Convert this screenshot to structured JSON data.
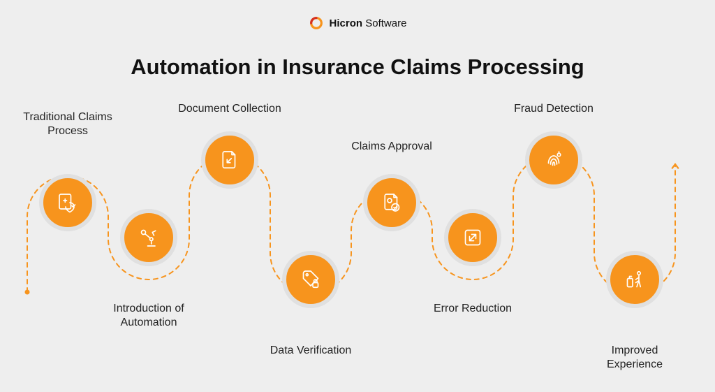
{
  "brand": {
    "name_bold": "Hicron",
    "name_light": "Software"
  },
  "title": "Automation in Insurance Claims Processing",
  "steps": [
    {
      "id": "traditional",
      "label": "Traditional Claims\nProcess",
      "icon": "health-shield"
    },
    {
      "id": "automation",
      "label": "Introduction of\nAutomation",
      "icon": "robot-arm"
    },
    {
      "id": "documents",
      "label": "Document Collection",
      "icon": "doc-arrow"
    },
    {
      "id": "data",
      "label": "Data Verification",
      "icon": "tag-lock"
    },
    {
      "id": "approval",
      "label": "Claims Approval",
      "icon": "doc-check"
    },
    {
      "id": "error",
      "label": "Error Reduction",
      "icon": "square-expand"
    },
    {
      "id": "fraud",
      "label": "Fraud Detection",
      "icon": "fingerprint"
    },
    {
      "id": "experience",
      "label": "Improved\nExperience",
      "icon": "person-kiosk"
    }
  ],
  "colors": {
    "accent": "#f7941d",
    "bg": "#eeeeee"
  }
}
